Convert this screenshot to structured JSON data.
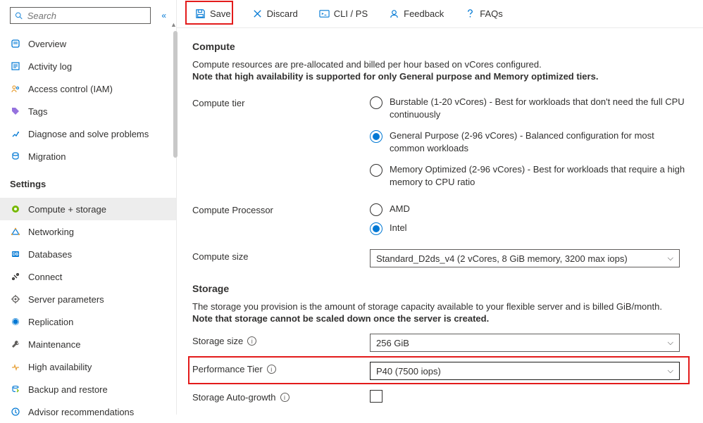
{
  "search": {
    "placeholder": "Search"
  },
  "nav": {
    "items1": [
      {
        "label": "Overview"
      },
      {
        "label": "Activity log"
      },
      {
        "label": "Access control (IAM)"
      },
      {
        "label": "Tags"
      },
      {
        "label": "Diagnose and solve problems"
      },
      {
        "label": "Migration"
      }
    ],
    "settings_heading": "Settings",
    "items2": [
      {
        "label": "Compute + storage"
      },
      {
        "label": "Networking"
      },
      {
        "label": "Databases"
      },
      {
        "label": "Connect"
      },
      {
        "label": "Server parameters"
      },
      {
        "label": "Replication"
      },
      {
        "label": "Maintenance"
      },
      {
        "label": "High availability"
      },
      {
        "label": "Backup and restore"
      },
      {
        "label": "Advisor recommendations"
      }
    ]
  },
  "toolbar": {
    "save": "Save",
    "discard": "Discard",
    "cli": "CLI / PS",
    "feedback": "Feedback",
    "faqs": "FAQs"
  },
  "compute": {
    "heading": "Compute",
    "desc1": "Compute resources are pre-allocated and billed per hour based on vCores configured.",
    "desc2": "Note that high availability is supported for only General purpose and Memory optimized tiers.",
    "tier_label": "Compute tier",
    "tier_options": [
      "Burstable (1-20 vCores) - Best for workloads that don't need the full CPU continuously",
      "General Purpose (2-96 vCores) - Balanced configuration for most common workloads",
      "Memory Optimized (2-96 vCores) - Best for workloads that require a high memory to CPU ratio"
    ],
    "processor_label": "Compute Processor",
    "processor_options": [
      "AMD",
      "Intel"
    ],
    "size_label": "Compute size",
    "size_value": "Standard_D2ds_v4 (2 vCores, 8 GiB memory, 3200 max iops)"
  },
  "storage": {
    "heading": "Storage",
    "desc1": "The storage you provision is the amount of storage capacity available to your flexible server and is billed GiB/month.",
    "desc2": "Note that storage cannot be scaled down once the server is created.",
    "size_label": "Storage size",
    "size_value": "256 GiB",
    "perf_label": "Performance Tier",
    "perf_value": "P40 (7500 iops)",
    "auto_label": "Storage Auto-growth"
  }
}
